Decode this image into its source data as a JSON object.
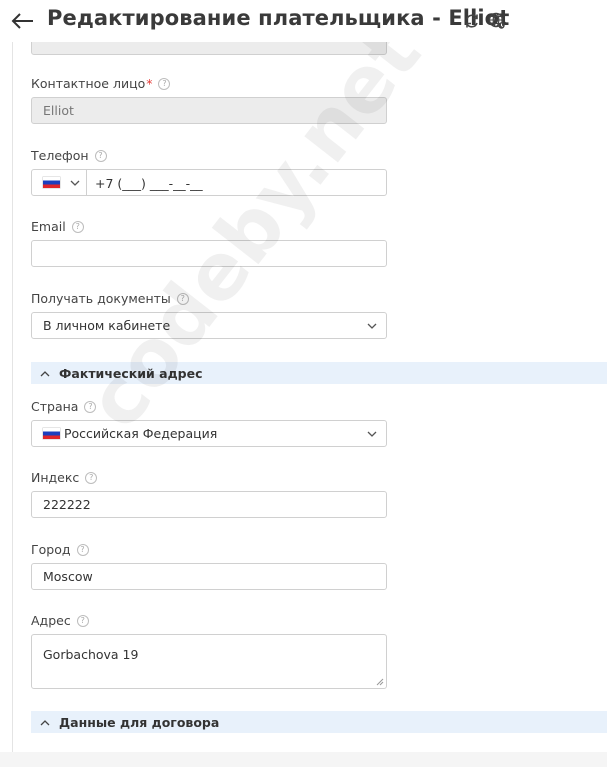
{
  "header": {
    "title": "Редактирование плательщика - Elliot"
  },
  "form": {
    "contact": {
      "label": "Контактное лицо",
      "required_mark": "*",
      "value": "Elliot"
    },
    "phone": {
      "label": "Телефон",
      "country_flag": "ru-flag-icon",
      "value": "+7 (___) ___-__-__"
    },
    "email": {
      "label": "Email",
      "value": ""
    },
    "documents": {
      "label": "Получать документы",
      "value": "В личном кабинете"
    }
  },
  "sections": {
    "actual_address": {
      "title": "Фактический адрес"
    },
    "contract_data": {
      "title": "Данные для договора"
    }
  },
  "address": {
    "country": {
      "label": "Страна",
      "value": "Российская Федерация"
    },
    "index": {
      "label": "Индекс",
      "value": "222222"
    },
    "city": {
      "label": "Город",
      "value": "Moscow"
    },
    "street": {
      "label": "Адрес",
      "value": "Gorbachova 19"
    }
  },
  "watermark": "codeby.net",
  "colors": {
    "section_bg": "#e8f1fb",
    "disabled_bg": "#ececec",
    "required": "#e53935"
  }
}
